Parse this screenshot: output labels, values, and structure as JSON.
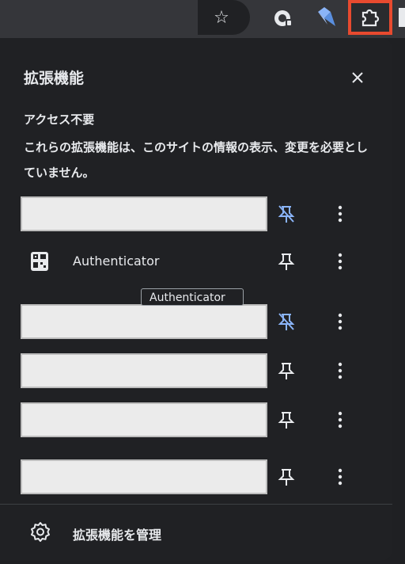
{
  "toolbar": {
    "bookmark_icon": "star-outline-icon",
    "extension_icons": [
      "password-manager-icon",
      "diamond-extension-icon"
    ],
    "extensions_button_icon": "puzzle-piece-icon",
    "highlight_color": "#e84a2f"
  },
  "panel": {
    "title": "拡張機能",
    "close_icon": "close-icon",
    "section_title": "アクセス不要",
    "section_desc": "これらの拡張機能は、このサイトの情報の表示、変更を必要としていません。",
    "pinned_color": "#8ab4f8",
    "extensions": [
      {
        "name": "",
        "pinned": true
      },
      {
        "name": "Authenticator",
        "pinned": false
      },
      {
        "name": "",
        "pinned": true
      },
      {
        "name": "",
        "pinned": false
      },
      {
        "name": "",
        "pinned": false
      },
      {
        "name": "",
        "pinned": false
      }
    ],
    "tooltip": "Authenticator",
    "manage_label": "拡張機能を管理"
  }
}
